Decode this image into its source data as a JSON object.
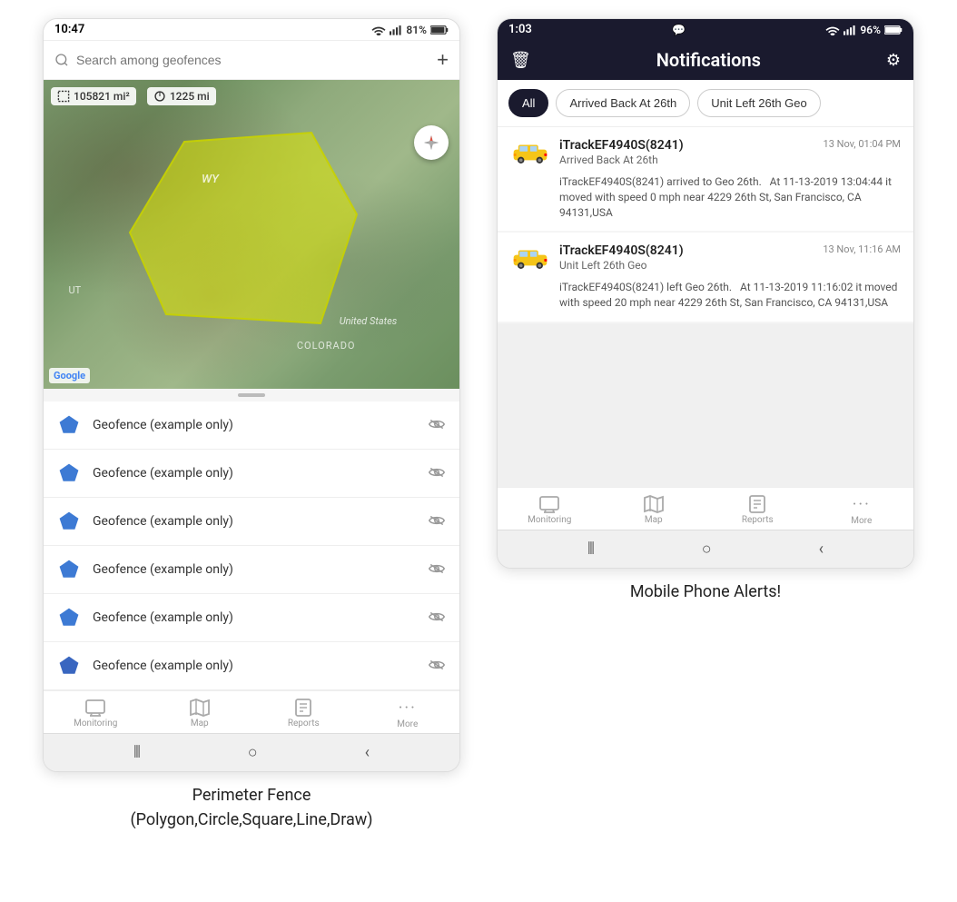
{
  "left_phone": {
    "status": {
      "time": "10:47",
      "wifi": "WiFi",
      "signal": "81%",
      "battery": "81%"
    },
    "search_placeholder": "Search among geofences",
    "map": {
      "stat1": "105821 mi²",
      "stat2": "1225 mi",
      "label_wy": "WY",
      "label_us": "United States",
      "label_co": "COLORADO",
      "label_ut": "UT",
      "google": "Google"
    },
    "geofences": [
      {
        "name": "Geofence (example only)"
      },
      {
        "name": "Geofence (example only)"
      },
      {
        "name": "Geofence (example only)"
      },
      {
        "name": "Geofence (example only)"
      },
      {
        "name": "Geofence (example only)"
      },
      {
        "name": "Geofence (example only)"
      }
    ],
    "nav": {
      "monitoring": "Monitoring",
      "map": "Map",
      "reports": "Reports",
      "more": "More"
    },
    "caption": "Perimeter Fence\n(Polygon,Circle,Square,Line,Draw)"
  },
  "right_phone": {
    "status": {
      "time": "1:03",
      "chat": "💬",
      "wifi": "WiFi",
      "signal": "96%"
    },
    "header": {
      "title": "Notifications",
      "delete_icon": "🗑",
      "settings_icon": "⚙"
    },
    "filters": [
      "All",
      "Arrived Back At 26th",
      "Unit Left 26th Geo"
    ],
    "active_filter": "All",
    "notifications": [
      {
        "device": "iTrackEF4940S(8241)",
        "time": "13 Nov, 01:04 PM",
        "event": "Arrived Back At 26th",
        "body": "iTrackEF4940S(8241) arrived to Geo 26th.   At 11-13-2019 13:04:44 it moved with speed 0 mph near 4229 26th St, San Francisco, CA 94131,USA"
      },
      {
        "device": "iTrackEF4940S(8241)",
        "time": "13 Nov, 11:16 AM",
        "event": "Unit Left 26th Geo",
        "body": "iTrackEF4940S(8241) left Geo 26th.   At 11-13-2019 11:16:02 it moved with speed 20 mph near 4229 26th St, San Francisco, CA 94131,USA"
      }
    ],
    "nav": {
      "monitoring": "Monitoring",
      "map": "Map",
      "reports": "Reports",
      "more": "More"
    },
    "caption": "Mobile Phone Alerts!"
  }
}
